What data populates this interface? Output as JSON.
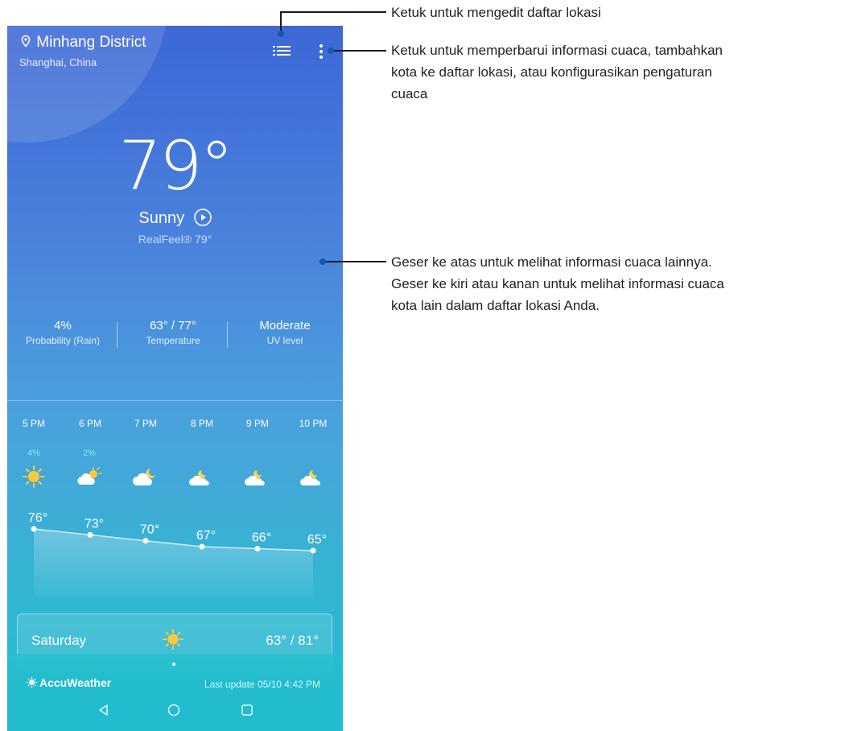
{
  "location": {
    "district": "Minhang District",
    "city": "Shanghai, China"
  },
  "current": {
    "temperature": "79°",
    "condition": "Sunny",
    "realfeel": "RealFeel® 79°"
  },
  "stats": [
    {
      "value": "4%",
      "label": "Probability (Rain)"
    },
    {
      "value": "63° / 77°",
      "label": "Temperature"
    },
    {
      "value": "Moderate",
      "label": "UV level"
    }
  ],
  "hourly": [
    {
      "time": "5 PM",
      "prob": "4%",
      "icon": "sun-icon",
      "temp": "76°",
      "temp_value": 76
    },
    {
      "time": "6 PM",
      "prob": "2%",
      "icon": "partly-cloudy-sun-icon",
      "temp": "73°",
      "temp_value": 73
    },
    {
      "time": "7 PM",
      "prob": "",
      "icon": "cloudy-moon-icon",
      "temp": "70°",
      "temp_value": 70
    },
    {
      "time": "8 PM",
      "prob": "",
      "icon": "moon-cloud-icon",
      "temp": "67°",
      "temp_value": 67
    },
    {
      "time": "9 PM",
      "prob": "",
      "icon": "moon-cloud-icon",
      "temp": "66°",
      "temp_value": 66
    },
    {
      "time": "10 PM",
      "prob": "",
      "icon": "moon-cloud-icon",
      "temp": "65°",
      "temp_value": 65
    }
  ],
  "daily": {
    "day": "Saturday",
    "icon": "sun-icon",
    "range": "63° / 81°"
  },
  "footer": {
    "brand": "AccuWeather",
    "last_update": "Last update 05/10 4:42 PM"
  },
  "callouts": {
    "edit_list": "Ketuk untuk mengedit daftar lokasi",
    "menu_line1": "Ketuk untuk memperbarui informasi cuaca, tambahkan",
    "menu_line2": "kota ke daftar lokasi, atau konfigurasikan pengaturan",
    "menu_line3": "cuaca",
    "swipe_line1": "Geser ke atas untuk melihat informasi cuaca lainnya.",
    "swipe_line2": "Geser ke kiri atau kanan untuk melihat informasi cuaca",
    "swipe_line3": "kota lain dalam daftar lokasi Anda."
  },
  "colors": {
    "gradient_top": "#3d67d6",
    "gradient_bottom": "#22bcce",
    "leader_dot": "#1558b0",
    "probability": "#7ff0ea"
  }
}
